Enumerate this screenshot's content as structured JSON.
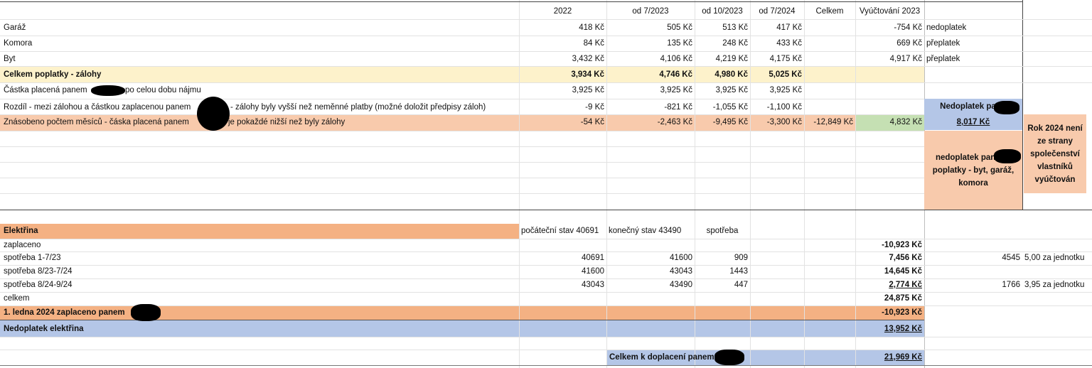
{
  "header": {
    "c2022": "2022",
    "c072023": "od 7/2023",
    "c102023": "od 10/2023",
    "c072024": "od 7/2024",
    "celkem": "Celkem",
    "vyuctovani": "Vyúčtování 2023"
  },
  "rows": {
    "garaz": {
      "label": "Garáž",
      "v2022": "418 Kč",
      "v072023": "505 Kč",
      "v102023": "513 Kč",
      "v072024": "417 Kč",
      "vyuct": "-754 Kč",
      "note": "nedoplatek"
    },
    "komora": {
      "label": "Komora",
      "v2022": "84 Kč",
      "v072023": "135 Kč",
      "v102023": "248 Kč",
      "v072024": "433 Kč",
      "vyuct": "669 Kč",
      "note": "přeplatek"
    },
    "byt": {
      "label": "Byt",
      "v2022": "3,432 Kč",
      "v072023": "4,106 Kč",
      "v102023": "4,219 Kč",
      "v072024": "4,175 Kč",
      "vyuct": "4,917 Kč",
      "note": "přeplatek"
    },
    "celkem": {
      "label": "Celkem poplatky - zálohy",
      "v2022": "3,934 Kč",
      "v072023": "4,746 Kč",
      "v102023": "4,980 Kč",
      "v072024": "5,025 Kč"
    },
    "castka": {
      "label_a": "Částka placená panem",
      "label_b": "po celou dobu nájmu",
      "v2022": "3,925 Kč",
      "v072023": "3,925 Kč",
      "v102023": "3,925 Kč",
      "v072024": "3,925 Kč"
    },
    "rozdil": {
      "label_a": "Rozdíl - mezi zálohou a částkou zaplacenou panem",
      "label_b": "- zálohy byly vyšší než neměnné platby (možné doložit předpisy záloh)",
      "v2022": "-9 Kč",
      "v072023": "-821 Kč",
      "v102023": "-1,055 Kč",
      "v072024": "-1,100 Kč"
    },
    "znasobeno": {
      "label_a": "Znásobeno počtem měsíců - čáska placená panem",
      "label_b": "je pokaždé nižší než byly zálohy",
      "v2022": "-54 Kč",
      "v072023": "-2,463 Kč",
      "v102023": "-9,495 Kč",
      "v072024": "-3,300 Kč",
      "celkem": "-12,849 Kč",
      "vyuct": "4,832 Kč"
    }
  },
  "side": {
    "nedoplatek_title": "Nedoplatek pan",
    "nedoplatek_value": "8,017 Kč",
    "nedoplatek_desc": "nedoplatek pana za poplatky - byt, garáž, komora",
    "rok2024": "Rok 2024 není ze strany společenství vlastníků vyúčtován"
  },
  "elektrina": {
    "title": "Elektřina",
    "pocatecni": "počáteční stav 40691",
    "konecny": "konečný stav 43490",
    "spotreba": "spotřeba",
    "zaplaceno": {
      "label": "zaplaceno",
      "value": "-10,923 Kč"
    },
    "r1": {
      "label": "spotřeba 1-7/23",
      "a": "40691",
      "b": "41600",
      "c": "909",
      "value": "7,456 Kč",
      "extra": "4545",
      "unit": "5,00 za jednotku"
    },
    "r2": {
      "label": "spotřeba 8/23-7/24",
      "a": "41600",
      "b": "43043",
      "c": "1443",
      "value": "14,645 Kč"
    },
    "r3": {
      "label": "spotřeba 8/24-9/24",
      "a": "43043",
      "b": "43490",
      "c": "447",
      "value": "2,774 Kč",
      "extra": "1766",
      "unit": "3,95 za jednotku"
    },
    "celkem": {
      "label": "celkem",
      "value": "24,875 Kč"
    },
    "ledna": {
      "label": "1. ledna 2024 zaplaceno panem",
      "value": "-10,923 Kč"
    },
    "nedoplatek": {
      "label": "Nedoplatek elektřina",
      "value": "13,952 Kč"
    },
    "total": {
      "label": "Celkem k doplacení panem",
      "value": "21,969 Kč"
    }
  },
  "colors": {
    "yellow": "#fdf2cb",
    "salmon": "#f8caac",
    "green": "#c5e0b3",
    "blue": "#b4c6e7",
    "orange": "#f4b183"
  }
}
